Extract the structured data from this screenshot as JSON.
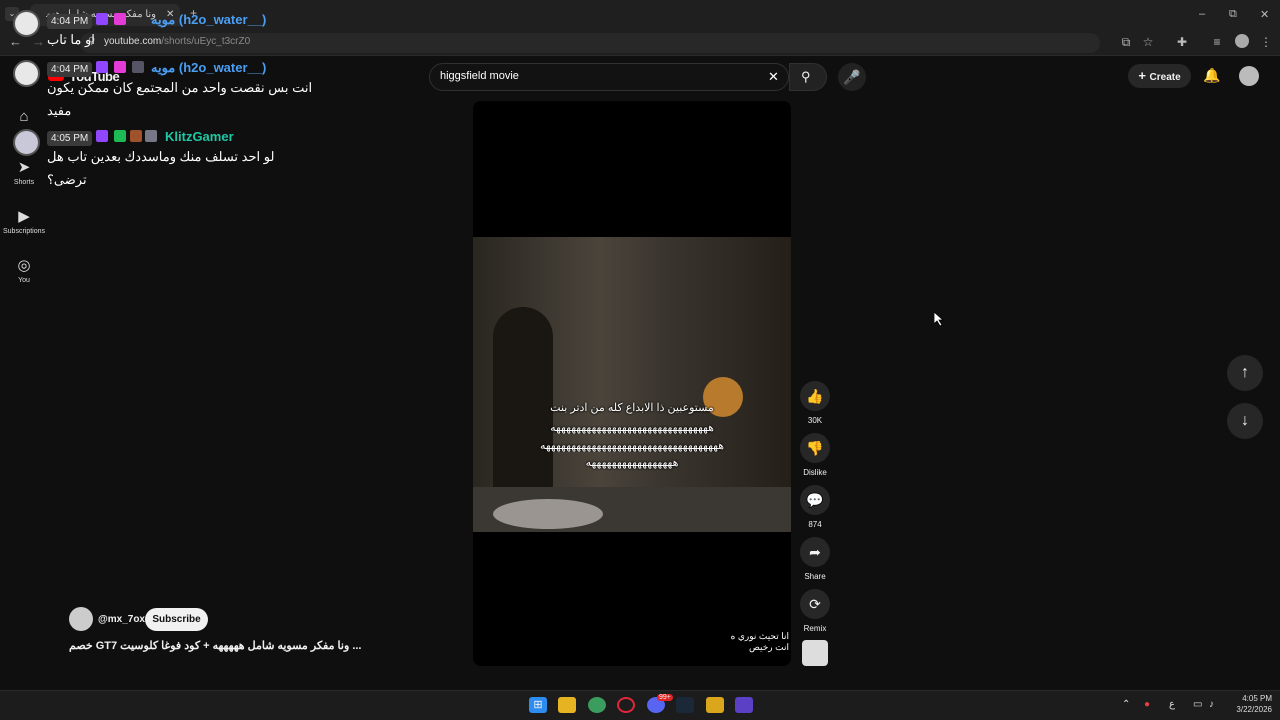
{
  "browser": {
    "tab_title": "ونا مفكر مسويه شامل هههههه",
    "url_domain": "youtube.com",
    "url_path": "/shorts/uEyc_t3crZ0",
    "win_minimize": "–",
    "win_restore": "⧉",
    "win_close": "✕",
    "new_tab": "+"
  },
  "chat": {
    "overlay_time": "4:04 PM",
    "overlay_user": "مويه (h2o_water__)",
    "overlay_text": "او ما تاب",
    "messages": [
      {
        "time": "4:04 PM",
        "user": "مويه (h2o_water__)",
        "color": "#4a9ff5",
        "text": "انت بس نقصت واحد من المجتمع كان ممكن يكون مفيد"
      },
      {
        "time": "4:05 PM",
        "user": "KlitzGamer",
        "color": "#1ec8a5",
        "text": "لو احد تسلف منك وماسددك بعدين تاب هل ترضى؟"
      }
    ]
  },
  "youtube": {
    "logo": "YouTube",
    "search_value": "higgsfield movie",
    "create_label": "Create",
    "nav": [
      {
        "label": "Home",
        "icon": "⌂"
      },
      {
        "label": "Shorts",
        "icon": "➤"
      },
      {
        "label": "Subscriptions",
        "icon": "▶"
      },
      {
        "label": "You",
        "icon": "◎"
      }
    ],
    "short": {
      "caption_line1": "مستوعبين ذا الابداع كله من ادتر بنت",
      "caption_line2": "هههههههههههههههههههههههههههههههه",
      "caption_line3": "هههههههههههههههههههههههههههههههههههه",
      "caption_line4": "هههههههههههههههههه",
      "corner_line1": "انا تحيث نوري ه",
      "corner_line2": "انت رخيص",
      "channel": "@mx_7ox",
      "subscribe": "Subscribe",
      "title": "... ونا مفكر مسويه شامل هههههه + كود فوغا كلوسيت GT7 خصم"
    },
    "actions": {
      "likes": "30K",
      "dislike": "Dislike",
      "comments": "874",
      "share": "Share",
      "remix": "Remix"
    }
  },
  "taskbar": {
    "time": "4:05 PM",
    "date": "3/22/2026",
    "lang": "ع",
    "badge": "99+"
  }
}
